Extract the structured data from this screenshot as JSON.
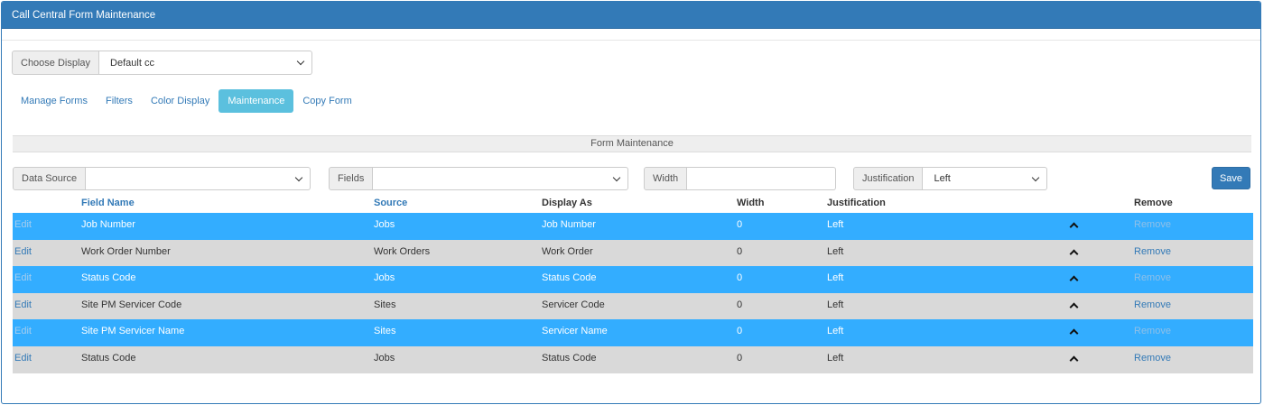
{
  "header": {
    "title": "Call Central Form Maintenance"
  },
  "display": {
    "label": "Choose Display",
    "value": "Default cc"
  },
  "tabs": [
    {
      "label": "Manage Forms"
    },
    {
      "label": "Filters"
    },
    {
      "label": "Color Display"
    },
    {
      "label": "Maintenance",
      "active": true
    },
    {
      "label": "Copy Form"
    }
  ],
  "section": {
    "title": "Form Maintenance"
  },
  "filters": {
    "data_source_label": "Data Source",
    "data_source_value": "",
    "fields_label": "Fields",
    "fields_value": "",
    "width_label": "Width",
    "width_value": "",
    "justification_label": "Justification",
    "justification_value": "Left"
  },
  "save_label": "Save",
  "table": {
    "columns": [
      "Field Name",
      "Source",
      "Display As",
      "Width",
      "Justification",
      "Remove"
    ],
    "rows": [
      {
        "edit": "Edit",
        "field_name": "Job Number",
        "source": "Jobs",
        "display_as": "Job Number",
        "width": "0",
        "justification": "Left",
        "remove": "Remove"
      },
      {
        "edit": "Edit",
        "field_name": "Work Order Number",
        "source": "Work Orders",
        "display_as": "Work Order",
        "width": "0",
        "justification": "Left",
        "remove": "Remove"
      },
      {
        "edit": "Edit",
        "field_name": "Status Code",
        "source": "Jobs",
        "display_as": "Status Code",
        "width": "0",
        "justification": "Left",
        "remove": "Remove"
      },
      {
        "edit": "Edit",
        "field_name": "Site PM Servicer Code",
        "source": "Sites",
        "display_as": "Servicer Code",
        "width": "0",
        "justification": "Left",
        "remove": "Remove"
      },
      {
        "edit": "Edit",
        "field_name": "Site PM Servicer Name",
        "source": "Sites",
        "display_as": "Servicer Name",
        "width": "0",
        "justification": "Left",
        "remove": "Remove"
      },
      {
        "edit": "Edit",
        "field_name": "Status Code",
        "source": "Jobs",
        "display_as": "Status Code",
        "width": "0",
        "justification": "Left",
        "remove": "Remove"
      }
    ]
  },
  "colors": {
    "header": "#337ab7",
    "row_highlight": "#33adff",
    "row_alt": "#d9d9d9",
    "active_tab": "#5bc0de"
  },
  "icons": {
    "move_up": "chevron-up-icon",
    "dropdown": "chevron-down-icon"
  }
}
